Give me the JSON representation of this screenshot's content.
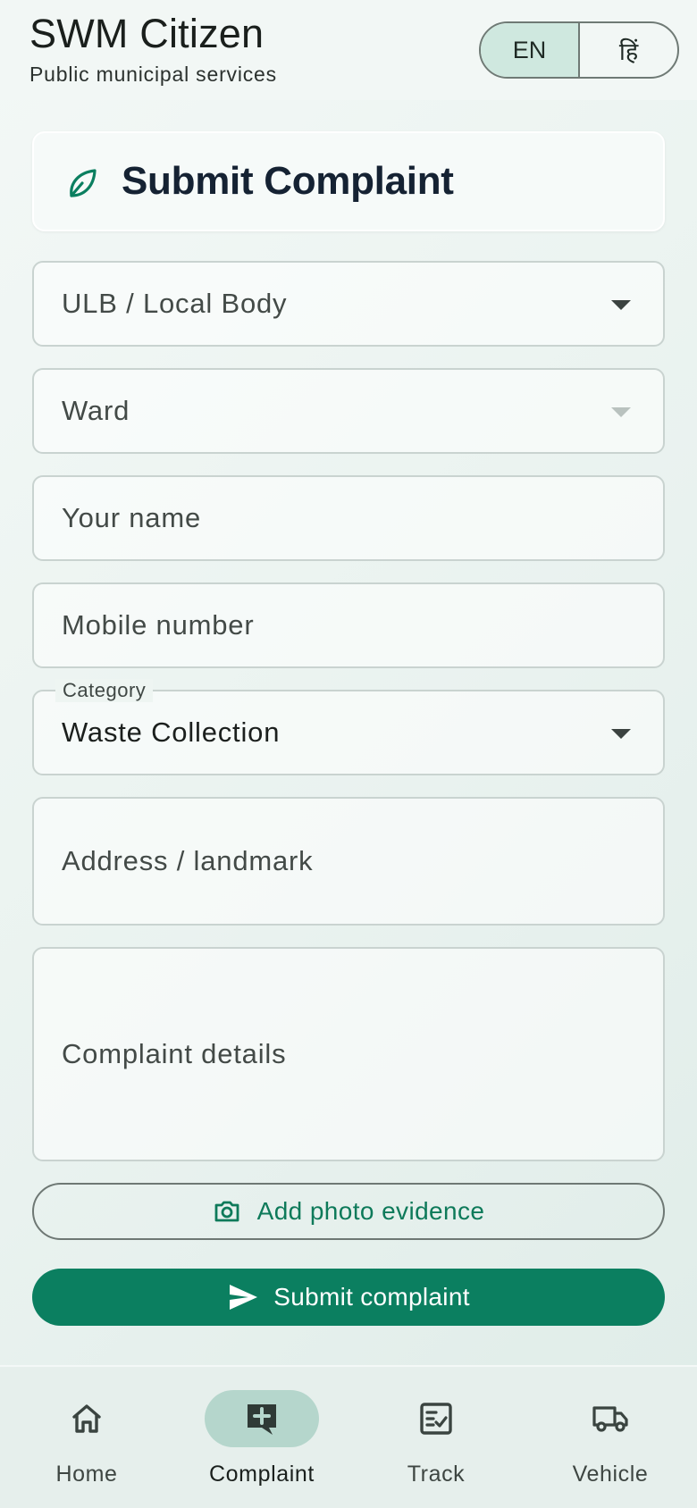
{
  "app": {
    "title": "SWM Citizen",
    "subtitle": "Public municipal services"
  },
  "language": {
    "options": [
      "EN",
      "हिं"
    ],
    "selected": "EN"
  },
  "form": {
    "title": "Submit Complaint",
    "title_icon": "leaf-icon",
    "ulb": {
      "placeholder": "ULB / Local Body",
      "value": ""
    },
    "ward": {
      "placeholder": "Ward",
      "value": "",
      "disabled": true
    },
    "name": {
      "placeholder": "Your name",
      "value": ""
    },
    "mobile": {
      "placeholder": "Mobile number",
      "value": ""
    },
    "category": {
      "label": "Category",
      "value": "Waste Collection"
    },
    "address": {
      "placeholder": "Address / landmark",
      "value": ""
    },
    "details": {
      "placeholder": "Complaint details",
      "value": ""
    },
    "photo_button": {
      "label": "Add photo evidence",
      "icon": "camera-icon"
    },
    "submit_button": {
      "label": "Submit complaint",
      "icon": "send-icon"
    }
  },
  "nav": {
    "items": [
      {
        "label": "Home",
        "icon": "home-icon"
      },
      {
        "label": "Complaint",
        "icon": "add-comment-icon"
      },
      {
        "label": "Track",
        "icon": "fact-check-icon"
      },
      {
        "label": "Vehicle",
        "icon": "truck-icon"
      }
    ],
    "active": "Complaint"
  },
  "colors": {
    "primary": "#0b7f60",
    "primary_text": "#0e7a5a",
    "title_text": "#152233",
    "nav_active_pill": "#b5d6cc",
    "lang_active": "#cfe8df"
  }
}
